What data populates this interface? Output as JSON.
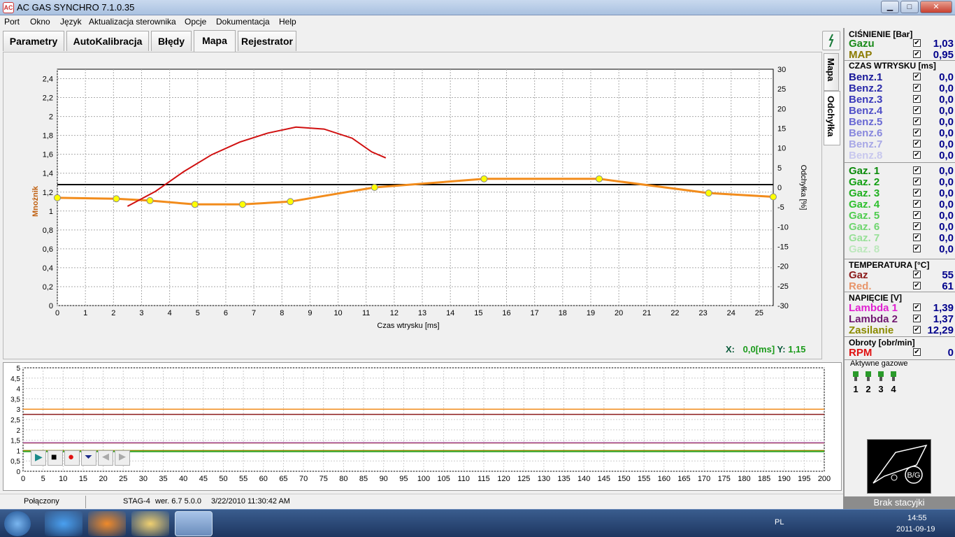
{
  "window": {
    "title": "AC GAS SYNCHRO  7.1.0.35",
    "min": "▁",
    "max": "□",
    "close": "✕"
  },
  "menu": [
    "Port",
    "Okno",
    "Język",
    "Aktualizacja sterownika",
    "Opcje",
    "Dokumentacja",
    "Help"
  ],
  "tabs": [
    "Parametry",
    "AutoKalibracja",
    "Błędy",
    "Mapa",
    "Rejestrator"
  ],
  "active_tab": "Mapa",
  "right_tabs": [
    "Mapa",
    "Odchyłka"
  ],
  "xy_readout": {
    "x_label": "X:",
    "x_value": "0,0[ms]",
    "y_label": "Y:",
    "y_value": "1,15"
  },
  "chart_data": [
    {
      "type": "line",
      "xlabel": "Czas wtrysku [ms]",
      "ylabel": "Mnożnik",
      "y2label": "Odchyłka [%]",
      "xlim": [
        0,
        25.5
      ],
      "ylim": [
        0,
        2.5
      ],
      "y2lim": [
        -30,
        30
      ],
      "x_ticks": [
        "0",
        "1",
        "2",
        "3",
        "4",
        "5",
        "6",
        "7",
        "8",
        "9",
        "10",
        "11",
        "12",
        "13",
        "14",
        "15",
        "16",
        "17",
        "18",
        "19",
        "20",
        "21",
        "22",
        "23",
        "24",
        "25"
      ],
      "y_ticks": [
        "0",
        "0,2",
        "0,4",
        "0,6",
        "0,8",
        "1",
        "1,2",
        "1,4",
        "1,6",
        "1,8",
        "2",
        "2,2",
        "2,4"
      ],
      "y2_ticks": [
        "30",
        "25",
        "20",
        "15",
        "10",
        "5",
        "0",
        "-5",
        "-10",
        "-15",
        "-20",
        "-25",
        "-30"
      ],
      "grid": true,
      "reference_line": {
        "y": 1.28,
        "color": "#000000"
      },
      "series": [
        {
          "color": "#f28c1c",
          "points": [
            [
              0,
              1.14
            ],
            [
              2.1,
              1.13
            ],
            [
              3.3,
              1.11
            ],
            [
              4.9,
              1.07
            ],
            [
              6.6,
              1.07
            ],
            [
              8.3,
              1.1
            ],
            [
              11.3,
              1.25
            ],
            [
              15.2,
              1.34
            ],
            [
              19.3,
              1.34
            ],
            [
              23.2,
              1.19
            ],
            [
              25.5,
              1.15
            ]
          ],
          "markers": [
            [
              0,
              1.14
            ],
            [
              2.1,
              1.13
            ],
            [
              3.3,
              1.11
            ],
            [
              4.9,
              1.07
            ],
            [
              6.6,
              1.07
            ],
            [
              8.3,
              1.1
            ],
            [
              11.3,
              1.25
            ],
            [
              15.2,
              1.34
            ],
            [
              19.3,
              1.34
            ],
            [
              23.2,
              1.19
            ],
            [
              25.5,
              1.15
            ]
          ]
        },
        {
          "color": "#d01010",
          "axis": "y2",
          "points": [
            [
              2.5,
              -4.8
            ],
            [
              3.5,
              -1
            ],
            [
              4.5,
              4
            ],
            [
              5.5,
              8.3
            ],
            [
              6.5,
              11.5
            ],
            [
              7.5,
              13.8
            ],
            [
              8.5,
              15.3
            ],
            [
              9.5,
              14.8
            ],
            [
              10.5,
              12.5
            ],
            [
              11.2,
              9
            ],
            [
              11.7,
              7.5
            ]
          ]
        }
      ]
    },
    {
      "type": "line",
      "xlim": [
        0,
        200
      ],
      "ylim": [
        0,
        5
      ],
      "x_ticks": [
        "0",
        "5",
        "10",
        "15",
        "20",
        "25",
        "30",
        "35",
        "40",
        "45",
        "50",
        "55",
        "60",
        "65",
        "70",
        "75",
        "80",
        "85",
        "90",
        "95",
        "100",
        "105",
        "110",
        "115",
        "120",
        "125",
        "130",
        "135",
        "140",
        "145",
        "150",
        "155",
        "160",
        "165",
        "170",
        "175",
        "180",
        "185",
        "190",
        "195",
        "200"
      ],
      "y_ticks": [
        "0",
        "0,5",
        "1",
        "1,5",
        "2",
        "2,5",
        "3",
        "3,5",
        "4",
        "4,5",
        "5"
      ],
      "grid": true,
      "series": [
        {
          "color": "#f28c1c",
          "values": [
            3.0
          ]
        },
        {
          "color": "#8b1a1a",
          "values": [
            2.75
          ]
        },
        {
          "color": "#8b1a1a",
          "values": [
            1.37
          ]
        },
        {
          "color": "#c080c0",
          "values": [
            1.39
          ]
        },
        {
          "color": "#8b8b00",
          "values": [
            1.0
          ]
        },
        {
          "color": "#1aa01a",
          "values": [
            0.95
          ]
        }
      ]
    }
  ],
  "player": {
    "play": "▶",
    "stop": "■",
    "record": "●",
    "down": "⏷",
    "left": "◀",
    "right": "▶"
  },
  "side": {
    "cisnienie": {
      "title": "CIŚNIENIE [Bar]",
      "rows": [
        {
          "label": "Gazu",
          "color": "#1a8a1a",
          "value": "1,03"
        },
        {
          "label": "MAP",
          "color": "#8b7a00",
          "value": "0,95"
        }
      ]
    },
    "czas": {
      "title": "CZAS WTRYSKU  [ms]",
      "rows": [
        {
          "label": "Benz.1",
          "color": "#1a1a9a",
          "value": "0,0"
        },
        {
          "label": "Benz.2",
          "color": "#2a2aaa",
          "value": "0,0"
        },
        {
          "label": "Benz.3",
          "color": "#3a3abb",
          "value": "0,0"
        },
        {
          "label": "Benz.4",
          "color": "#5050c8",
          "value": "0,0"
        },
        {
          "label": "Benz.5",
          "color": "#6868d4",
          "value": "0,0"
        },
        {
          "label": "Benz.6",
          "color": "#8888dd",
          "value": "0,0"
        },
        {
          "label": "Benz.7",
          "color": "#a8a8e6",
          "value": "0,0"
        },
        {
          "label": "Benz.8",
          "color": "#c8c8ee",
          "value": "0,0"
        }
      ]
    },
    "gaz": {
      "rows": [
        {
          "label": "Gaz. 1",
          "color": "#0a8a0a",
          "value": "0,0"
        },
        {
          "label": "Gaz. 2",
          "color": "#14a014",
          "value": "0,0"
        },
        {
          "label": "Gaz. 3",
          "color": "#20b020",
          "value": "0,0"
        },
        {
          "label": "Gaz. 4",
          "color": "#30c030",
          "value": "0,0"
        },
        {
          "label": "Gaz. 5",
          "color": "#50cc50",
          "value": "0,0"
        },
        {
          "label": "Gaz. 6",
          "color": "#70d670",
          "value": "0,0"
        },
        {
          "label": "Gaz. 7",
          "color": "#98e098",
          "value": "0,0"
        },
        {
          "label": "Gaz. 8",
          "color": "#bce8bc",
          "value": "0,0"
        }
      ]
    },
    "temperatura": {
      "title": "TEMPERATURA  [°C]",
      "rows": [
        {
          "label": "Gaz",
          "color": "#8b1a1a",
          "value": "55"
        },
        {
          "label": "Red.",
          "color": "#e8956a",
          "value": "61"
        }
      ]
    },
    "napiecie": {
      "title": "NAPIĘCIE [V]",
      "rows": [
        {
          "label": "Lambda 1",
          "color": "#e020d0",
          "value": "1,39"
        },
        {
          "label": "Lambda 2",
          "color": "#701870",
          "value": "1,37"
        },
        {
          "label": "Zasilanie",
          "color": "#8b8b00",
          "value": "12,29"
        }
      ]
    },
    "obroty": {
      "title": "Obroty [obr/min]",
      "rows": [
        {
          "label": "RPM",
          "color": "#e01010",
          "value": "0"
        }
      ]
    },
    "aktywne": {
      "title": "Aktywne gazowe",
      "items": [
        "1",
        "2",
        "3",
        "4"
      ]
    },
    "check": "✔"
  },
  "logo_text": "B/G",
  "brak": "Brak stacyjki",
  "status": {
    "conn": "Połączony",
    "device": "STAG-4",
    "ver": "wer. 6.7  5.0.0",
    "date": "3/22/2010 11:30:42 AM"
  },
  "taskbar": {
    "lang": "PL",
    "time": "14:55",
    "date": "2011-09-19"
  }
}
